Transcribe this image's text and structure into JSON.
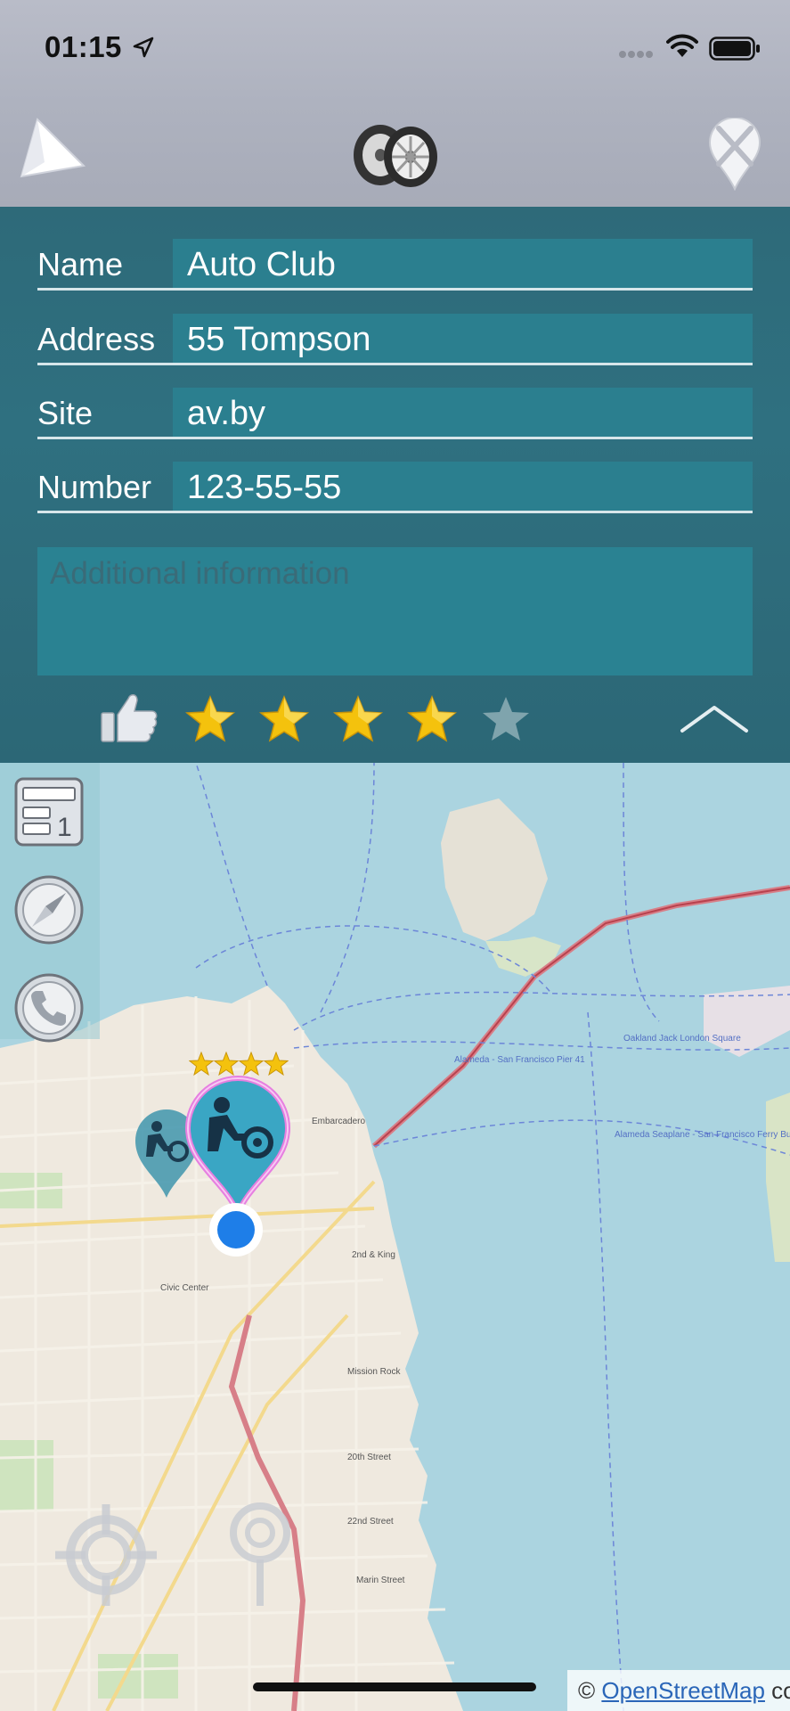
{
  "status_bar": {
    "time": "01:15",
    "icons": [
      "location-arrow-icon",
      "signal-dots-icon",
      "wifi-icon",
      "battery-icon"
    ]
  },
  "header": {
    "left_icon": "navigation-arrow-icon",
    "center_icon": "tires-icon",
    "right_icon": "remove-pin-icon"
  },
  "form": {
    "rows": [
      {
        "label": "Name",
        "value": "Auto Club"
      },
      {
        "label": "Address",
        "value": "55 Tompson"
      },
      {
        "label": "Site",
        "value": "av.by"
      },
      {
        "label": "Number",
        "value": "123-55-55"
      }
    ],
    "notes_placeholder": "Additional information",
    "rating": {
      "value": 4,
      "max": 5
    },
    "icons": {
      "like": "thumbs-up-icon",
      "collapse": "chevron-up-icon"
    }
  },
  "map": {
    "side_buttons": [
      "list-one-icon",
      "compass-icon",
      "phone-icon"
    ],
    "pin_rating": {
      "value": 4,
      "max": 4
    },
    "bottom_buttons": [
      "crosshair-icon",
      "drop-pin-icon"
    ],
    "attribution_prefix": "© ",
    "attribution_link": "OpenStreetMap",
    "attribution_suffix": " co"
  },
  "colors": {
    "panel": "#2e6a79",
    "field": "#2b7f8f",
    "star_on": "#f4c20d",
    "star_off": "#7fa4ad",
    "water": "#abd4e0",
    "user_dot": "#1e7ee8"
  }
}
